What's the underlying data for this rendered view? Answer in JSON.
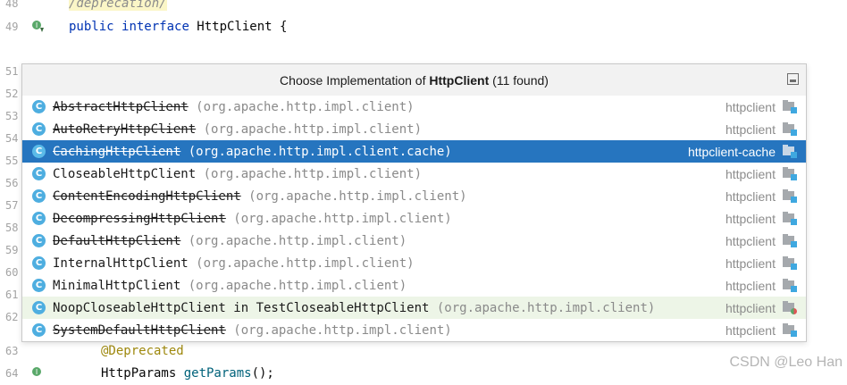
{
  "editor": {
    "lines": [
      {
        "no": "48",
        "code_html": "hl",
        "text": "/deprecation/"
      },
      {
        "no": "49",
        "text": "HttpClient {"
      },
      {
        "no": "51"
      },
      {
        "no": "52"
      },
      {
        "no": "53"
      },
      {
        "no": "54"
      },
      {
        "no": "55"
      },
      {
        "no": "56"
      },
      {
        "no": "57"
      },
      {
        "no": "58"
      },
      {
        "no": "59"
      },
      {
        "no": "60"
      },
      {
        "no": "61"
      },
      {
        "no": "62"
      },
      {
        "no": "63",
        "text": "@Deprecated"
      },
      {
        "no": "64",
        "text": "HttpParams getParams();"
      }
    ],
    "line49_kw1": "public",
    "line49_kw2": "interface",
    "line49_rest": " HttpClient {",
    "line63_text": "@Deprecated",
    "line64_type": "HttpParams ",
    "line64_method": "getParams",
    "line64_tail": "();"
  },
  "popup": {
    "title_prefix": "Choose Implementation of ",
    "title_class": "HttpClient",
    "title_suffix": " (11 found)",
    "items": [
      {
        "name": "AbstractHttpClient",
        "package": " (org.apache.http.impl.client)",
        "module": "httpclient",
        "deprecated": true
      },
      {
        "name": "AutoRetryHttpClient",
        "package": " (org.apache.http.impl.client)",
        "module": "httpclient",
        "deprecated": true
      },
      {
        "name": "CachingHttpClient",
        "package": " (org.apache.http.impl.client.cache)",
        "module": "httpclient-cache",
        "deprecated": true,
        "selected": true
      },
      {
        "name": "CloseableHttpClient",
        "package": " (org.apache.http.impl.client)",
        "module": "httpclient",
        "deprecated": false
      },
      {
        "name": "ContentEncodingHttpClient",
        "package": " (org.apache.http.impl.client)",
        "module": "httpclient",
        "deprecated": true
      },
      {
        "name": "DecompressingHttpClient",
        "package": " (org.apache.http.impl.client)",
        "module": "httpclient",
        "deprecated": true
      },
      {
        "name": "DefaultHttpClient",
        "package": " (org.apache.http.impl.client)",
        "module": "httpclient",
        "deprecated": true
      },
      {
        "name": "InternalHttpClient",
        "package": " (org.apache.http.impl.client)",
        "module": "httpclient",
        "deprecated": false
      },
      {
        "name": "MinimalHttpClient",
        "package": " (org.apache.http.impl.client)",
        "module": "httpclient",
        "deprecated": false
      },
      {
        "name": "NoopCloseableHttpClient in TestCloseableHttpClient",
        "package": " (org.apache.http.impl.client)",
        "module": "httpclient",
        "deprecated": false,
        "test": true
      },
      {
        "name": "SystemDefaultHttpClient",
        "package": " (org.apache.http.impl.client)",
        "module": "httpclient",
        "deprecated": true
      }
    ],
    "class_icon_letter": "C"
  },
  "watermark": "CSDN @Leo Han"
}
